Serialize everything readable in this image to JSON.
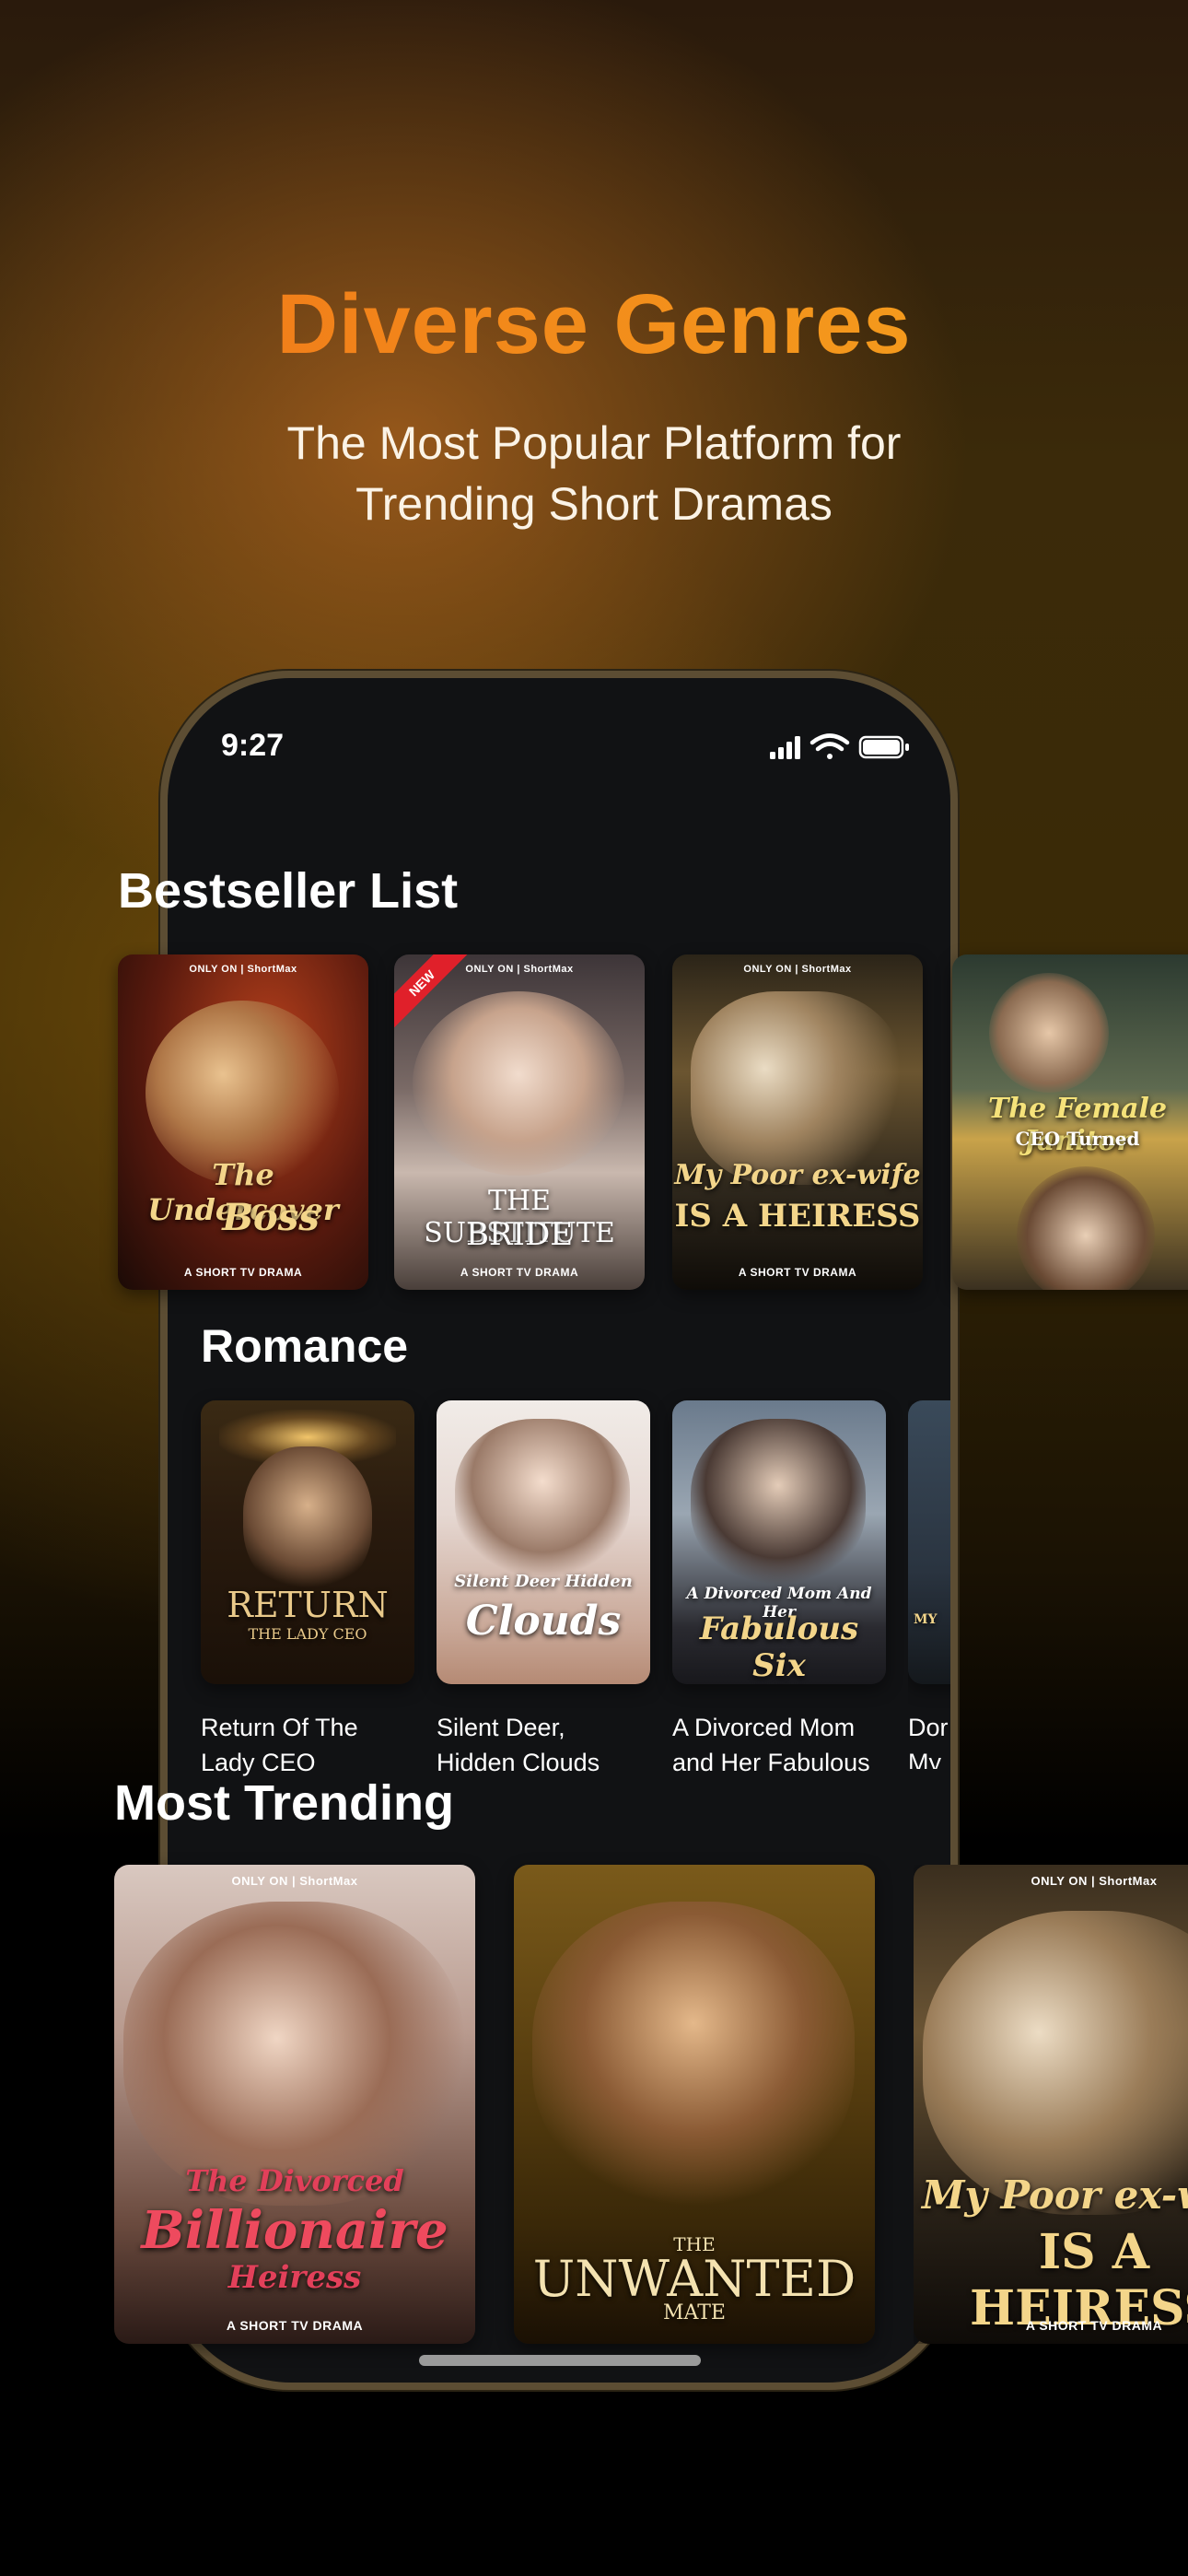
{
  "hero": {
    "title": "Diverse Genres",
    "subtitle_line1": "The Most Popular Platform for",
    "subtitle_line2": "Trending Short Dramas"
  },
  "status_bar": {
    "time": "9:27",
    "icons": [
      "cellular-signal-icon",
      "wifi-icon",
      "battery-icon"
    ]
  },
  "bestseller": {
    "title": "Bestseller List",
    "cards": [
      {
        "top": "ONLY ON | ShortMax",
        "line1": "The Undercover",
        "line2": "Boss",
        "bottom": "A SHORT TV DRAMA"
      },
      {
        "top": "ONLY ON | ShortMax",
        "line1": "THE SUBSTITUTE",
        "line2": "BRIDE",
        "bottom": "A SHORT TV DRAMA",
        "ribbon": "NEW"
      },
      {
        "top": "ONLY ON | ShortMax",
        "line1": "My Poor ex-wife",
        "line2": "IS A HEIRESS",
        "bottom": "A SHORT TV DRAMA"
      },
      {
        "line1": "The Female Janitor",
        "line2": "CEO Turned"
      }
    ]
  },
  "romance": {
    "title": "Romance",
    "cards": [
      {
        "poster_line1": "RETURN",
        "poster_line2": "THE LADY CEO",
        "label": "Return Of The Lady CEO",
        "label_line1": "Return Of The",
        "label_line2": "Lady CEO"
      },
      {
        "poster_line1": "Silent Deer Hidden",
        "poster_line2": "Clouds",
        "label": "Silent Deer, Hidden Clouds",
        "label_line1": "Silent Deer,",
        "label_line2": "Hidden Clouds"
      },
      {
        "poster_line1": "A Divorced Mom And Her",
        "poster_line2": "Fabulous Six",
        "label": "A Divorced Mom and Her Fabulous",
        "label_line1": "A Divorced Mom",
        "label_line2": "and Her Fabulous"
      },
      {
        "poster_line1": "",
        "poster_line2": "MY",
        "label_line1": "Dor",
        "label_line2": "My I"
      }
    ]
  },
  "trending": {
    "title": "Most Trending",
    "cards": [
      {
        "top": "ONLY ON | ShortMax",
        "line1": "The Divorced",
        "line2": "Billionaire",
        "line3": "Heiress",
        "bottom": "A SHORT TV DRAMA"
      },
      {
        "line1": "THE",
        "line2": "UNWANTED",
        "line3": "MATE"
      },
      {
        "top": "ONLY ON | ShortMax",
        "line1": "My Poor ex-wife",
        "line2": "IS A HEIRESS",
        "bottom": "A SHORT TV DRAMA"
      }
    ]
  },
  "colors": {
    "title_gradient_start": "#f07418",
    "title_gradient_end": "#f5a51e",
    "screen_bg": "#111214",
    "phone_frame": "#5c4d33",
    "ribbon": "#e0202a"
  }
}
